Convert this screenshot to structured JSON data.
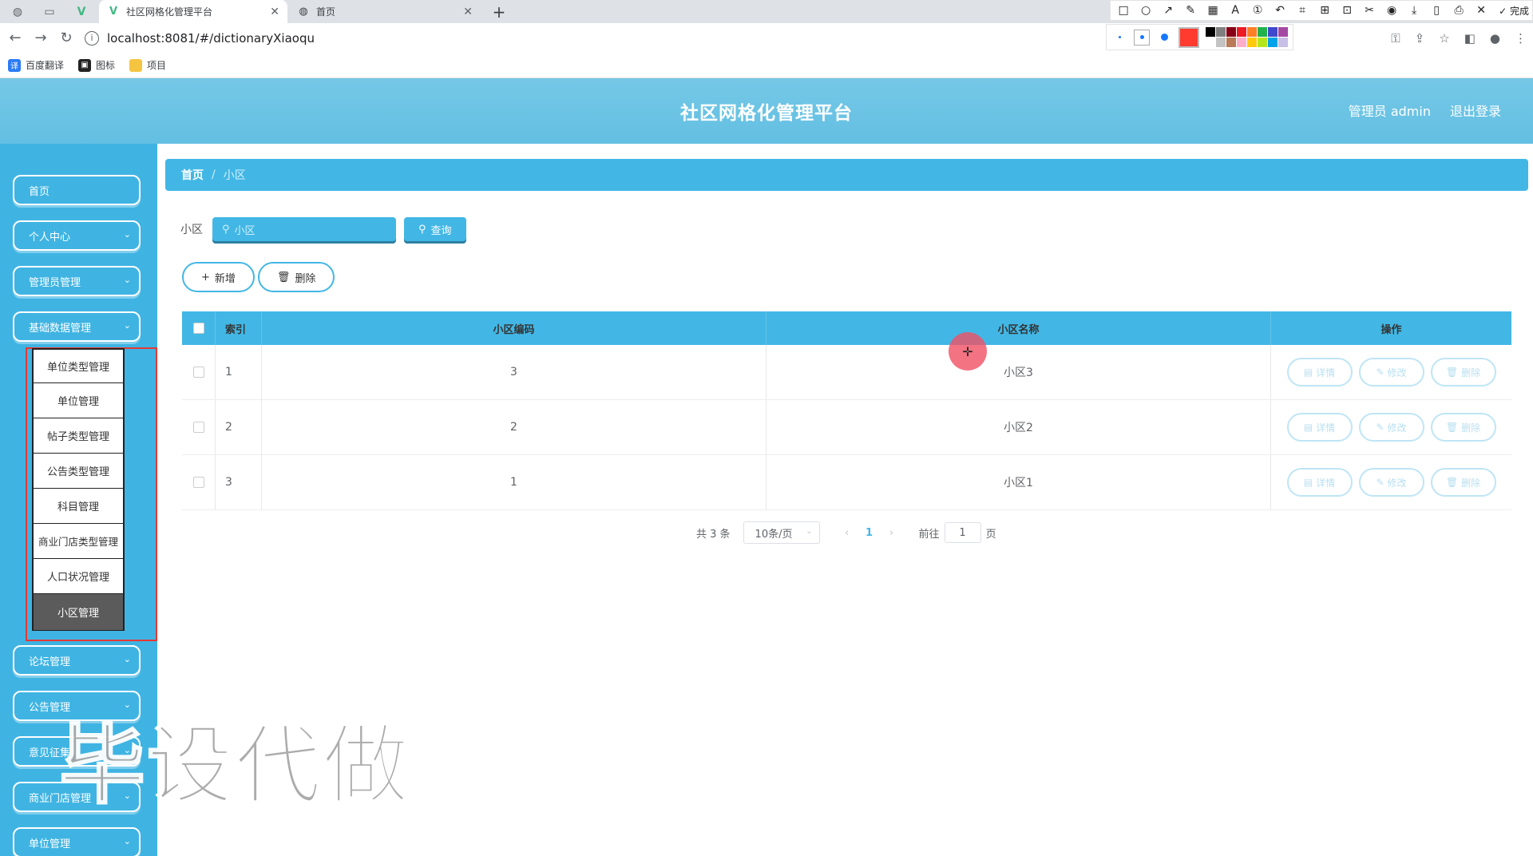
{
  "browser": {
    "tabs": [
      {
        "title": "社区网格化管理平台",
        "active": true
      },
      {
        "title": "首页",
        "active": false
      }
    ],
    "url": "localhost:8081/#/dictionaryXiaoqu",
    "bookmarks": [
      "百度翻译",
      "图标",
      "项目"
    ],
    "screenshot_toolbar_done": "完成",
    "palette_current_color": "#ff3b30",
    "palette_colors": [
      "#000000",
      "#7f7f7f",
      "#880015",
      "#ed1c24",
      "#ff7f27",
      "#22b14c",
      "#3f48cc",
      "#a349a4",
      "#ffffff",
      "#c3c3c3",
      "#b97a57",
      "#ffaec9",
      "#ffc90e",
      "#b5e61d",
      "#00a2e8",
      "#c8bfe7"
    ]
  },
  "header": {
    "title": "社区网格化管理平台",
    "user": "管理员 admin",
    "logout": "退出登录",
    "color": "#6bc4e4"
  },
  "sidebar": {
    "items": [
      {
        "label": "首页",
        "has_arrow": false
      },
      {
        "label": "个人中心",
        "has_arrow": true
      },
      {
        "label": "管理员管理",
        "has_arrow": true
      },
      {
        "label": "基础数据管理",
        "has_arrow": true
      }
    ],
    "submenu": [
      "单位类型管理",
      "单位管理",
      "帖子类型管理",
      "公告类型管理",
      "科目管理",
      "商业门店类型管理",
      "人口状况管理",
      "小区管理"
    ],
    "submenu_active": "小区管理",
    "items_after": [
      {
        "label": "论坛管理"
      },
      {
        "label": "公告管理"
      },
      {
        "label": "意见征集"
      },
      {
        "label": "商业门店管理"
      },
      {
        "label": "单位管理"
      }
    ]
  },
  "breadcrumb": {
    "home": "首页",
    "separator": "/",
    "current": "小区"
  },
  "search": {
    "label": "小区",
    "placeholder": "小区",
    "button": "查询"
  },
  "actions": {
    "add": "新增",
    "delete": "删除"
  },
  "table": {
    "headers": {
      "index": "索引",
      "code": "小区编码",
      "name": "小区名称",
      "ops": "操作"
    },
    "rows": [
      {
        "index": "1",
        "code": "3",
        "name": "小区3"
      },
      {
        "index": "2",
        "code": "2",
        "name": "小区2"
      },
      {
        "index": "3",
        "code": "1",
        "name": "小区1"
      }
    ],
    "row_actions": {
      "detail": "详情",
      "edit": "修改",
      "delete": "删除"
    }
  },
  "pagination": {
    "total": "共 3 条",
    "page_size": "10条/页",
    "current_page": "1",
    "goto_prefix": "前往",
    "goto_value": "1",
    "goto_suffix": "页"
  },
  "watermark": "毕设代做",
  "accent_color": "#42b7e5"
}
